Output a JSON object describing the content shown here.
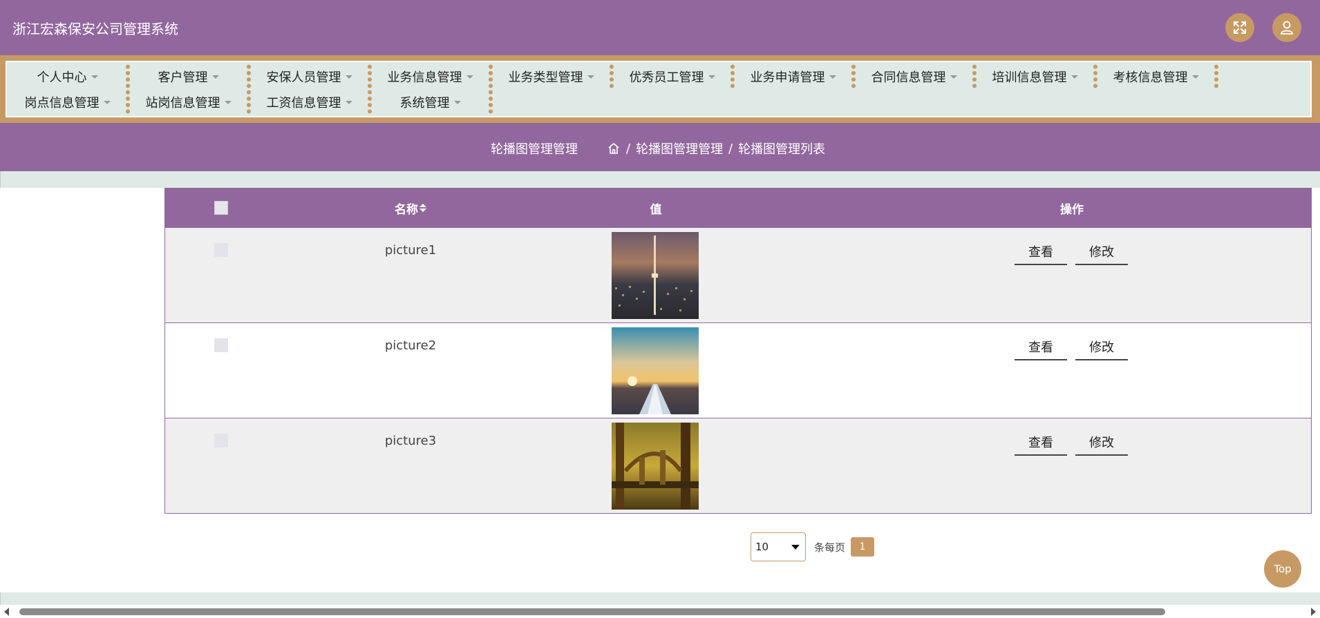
{
  "app": {
    "title": "浙江宏森保安公司管理系统"
  },
  "header": {
    "fullscreen_icon": "fullscreen-expand-icon",
    "user_icon": "user-icon"
  },
  "nav": {
    "row1": [
      "个人中心",
      "客户管理",
      "安保人员管理",
      "业务信息管理",
      "业务类型管理",
      "优秀员工管理",
      "业务申请管理",
      "合同信息管理",
      "培训信息管理",
      "考核信息管理"
    ],
    "row2": [
      "岗点信息管理",
      "站岗信息管理",
      "工资信息管理",
      "系统管理"
    ]
  },
  "breadcrumb": {
    "title": "轮播图管理管理",
    "home_icon": "home-icon",
    "path": [
      "轮播图管理管理",
      "轮播图管理列表"
    ],
    "separator": "/"
  },
  "table": {
    "headers": {
      "name": "名称",
      "value": "值",
      "actions": "操作"
    },
    "rows": [
      {
        "name": "picture1",
        "image_desc": "city-night-skyline-thumbnail",
        "view": "查看",
        "edit": "修改"
      },
      {
        "name": "picture2",
        "image_desc": "sunset-road-thumbnail",
        "view": "查看",
        "edit": "修改"
      },
      {
        "name": "picture3",
        "image_desc": "golden-bridge-thumbnail",
        "view": "查看",
        "edit": "修改"
      }
    ]
  },
  "pagination": {
    "page_size": "10",
    "per_page_label": "条每页",
    "current_page": "1"
  },
  "top_button": "Top",
  "colors": {
    "header_purple": "#92679e",
    "accent_tan": "#c79a64",
    "nav_bg": "#dfeae6"
  }
}
